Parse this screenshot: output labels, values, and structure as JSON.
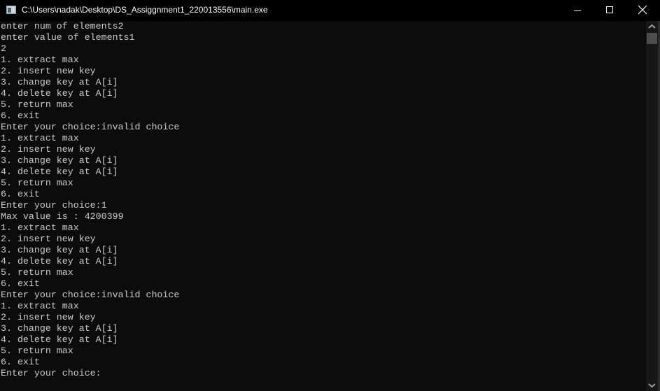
{
  "window": {
    "title": "C:\\Users\\nadak\\Desktop\\DS_Assiggnment1_220013556\\main.exe",
    "icon": "console-app-icon",
    "controls": [
      "minimize",
      "maximize",
      "close"
    ]
  },
  "console": {
    "lines": [
      "enter num of elements2",
      "enter value of elements1",
      "2",
      "1. extract max",
      "2. insert new key",
      "3. change key at A[i]",
      "4. delete key at A[i]",
      "5. return max",
      "6. exit",
      "Enter your choice:invalid choice",
      "1. extract max",
      "2. insert new key",
      "3. change key at A[i]",
      "4. delete key at A[i]",
      "5. return max",
      "6. exit",
      "Enter your choice:1",
      "Max value is : 4200399",
      "1. extract max",
      "2. insert new key",
      "3. change key at A[i]",
      "4. delete key at A[i]",
      "5. return max",
      "6. exit",
      "Enter your choice:invalid choice",
      "1. extract max",
      "2. insert new key",
      "3. change key at A[i]",
      "4. delete key at A[i]",
      "5. return max",
      "6. exit",
      "Enter your choice:"
    ]
  },
  "colors": {
    "background": "#0c0c0c",
    "text": "#cccccc",
    "titlebar": "#000000"
  }
}
